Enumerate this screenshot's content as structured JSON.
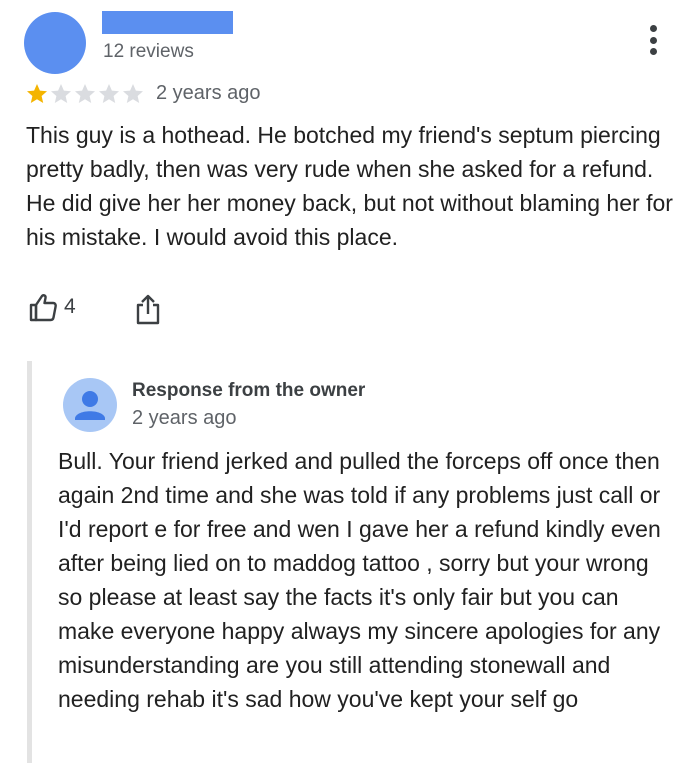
{
  "review": {
    "reviews_count": "12 reviews",
    "rating": 1,
    "rating_max": 5,
    "time_ago": "2 years ago",
    "text": "This guy is a hothead. He botched my friend's septum piercing pretty badly, then was very rude when she asked for a refund. He did give her her money back, but not without blaming her for his mistake. I would avoid this place.",
    "likes": "4",
    "icons": {
      "avatar": "avatar",
      "more": "more-vert-icon",
      "like": "thumbs-up-icon",
      "share": "share-icon"
    }
  },
  "response": {
    "title": "Response from the owner",
    "time_ago": "2 years ago",
    "text": "Bull. Your friend jerked and pulled the forceps off once then again 2nd time and she was told if any problems just call or I'd report e for free and wen I gave her a refund kindly even after being lied on to maddog tattoo , sorry but your wrong so please at least say the facts it's only fair but you can make everyone happy always my sincere apologies for any misunderstanding are you still attending stonewall and needing rehab it's sad how you've kept your self go"
  },
  "colors": {
    "avatar_blue": "#5b8ff0",
    "star_filled": "#f4b400",
    "star_empty": "#dadce0",
    "secondary_text": "#5f6368",
    "response_border": "#e3e3e3"
  }
}
